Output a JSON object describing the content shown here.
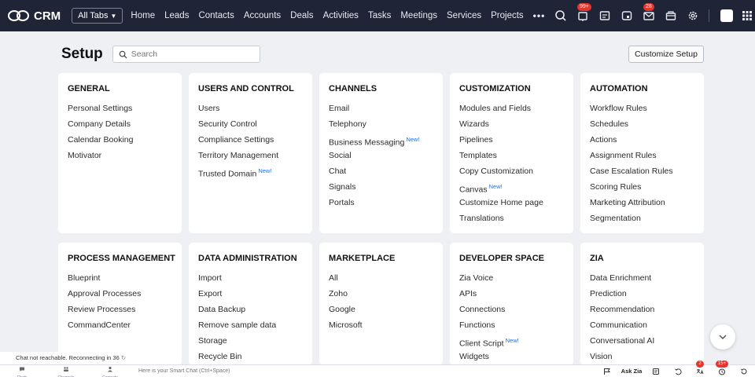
{
  "app": {
    "logo_text": "CRM",
    "all_tabs": "All Tabs"
  },
  "nav": [
    "Home",
    "Leads",
    "Contacts",
    "Accounts",
    "Deals",
    "Activities",
    "Tasks",
    "Meetings",
    "Services",
    "Projects"
  ],
  "nav_more": "•••",
  "top_badges": {
    "notifications": "99+",
    "mail": "28"
  },
  "setup": {
    "title": "Setup",
    "search_placeholder": "Search",
    "customize_button": "Customize Setup"
  },
  "new_label": "New!",
  "sections": [
    {
      "title": "GENERAL",
      "items": [
        {
          "label": "Personal Settings"
        },
        {
          "label": "Company Details"
        },
        {
          "label": "Calendar Booking"
        },
        {
          "label": "Motivator"
        }
      ]
    },
    {
      "title": "USERS AND CONTROL",
      "items": [
        {
          "label": "Users"
        },
        {
          "label": "Security Control"
        },
        {
          "label": "Compliance Settings"
        },
        {
          "label": "Territory Management"
        },
        {
          "label": "Trusted Domain",
          "new": true
        }
      ]
    },
    {
      "title": "CHANNELS",
      "items": [
        {
          "label": "Email"
        },
        {
          "label": "Telephony"
        },
        {
          "label": "Business Messaging",
          "new": true
        },
        {
          "label": "Social"
        },
        {
          "label": "Chat"
        },
        {
          "label": "Signals"
        },
        {
          "label": "Portals"
        }
      ]
    },
    {
      "title": "CUSTOMIZATION",
      "items": [
        {
          "label": "Modules and Fields"
        },
        {
          "label": "Wizards"
        },
        {
          "label": "Pipelines"
        },
        {
          "label": "Templates"
        },
        {
          "label": "Copy Customization"
        },
        {
          "label": "Canvas",
          "new": true
        },
        {
          "label": "Customize Home page"
        },
        {
          "label": "Translations"
        }
      ]
    },
    {
      "title": "AUTOMATION",
      "items": [
        {
          "label": "Workflow Rules"
        },
        {
          "label": "Schedules"
        },
        {
          "label": "Actions"
        },
        {
          "label": "Assignment Rules"
        },
        {
          "label": "Case Escalation Rules"
        },
        {
          "label": "Scoring Rules"
        },
        {
          "label": "Marketing Attribution"
        },
        {
          "label": "Segmentation"
        }
      ]
    },
    {
      "title": "PROCESS MANAGEMENT",
      "items": [
        {
          "label": "Blueprint"
        },
        {
          "label": "Approval Processes"
        },
        {
          "label": "Review Processes"
        },
        {
          "label": "CommandCenter"
        }
      ]
    },
    {
      "title": "DATA ADMINISTRATION",
      "items": [
        {
          "label": "Import"
        },
        {
          "label": "Export"
        },
        {
          "label": "Data Backup"
        },
        {
          "label": "Remove sample data"
        },
        {
          "label": "Storage"
        },
        {
          "label": "Recycle Bin"
        }
      ]
    },
    {
      "title": "MARKETPLACE",
      "items": [
        {
          "label": "All"
        },
        {
          "label": "Zoho"
        },
        {
          "label": "Google"
        },
        {
          "label": "Microsoft"
        }
      ]
    },
    {
      "title": "DEVELOPER SPACE",
      "items": [
        {
          "label": "Zia Voice"
        },
        {
          "label": "APIs"
        },
        {
          "label": "Connections"
        },
        {
          "label": "Functions"
        },
        {
          "label": "Client Script",
          "new": true
        },
        {
          "label": "Widgets"
        }
      ]
    },
    {
      "title": "ZIA",
      "items": [
        {
          "label": "Data Enrichment"
        },
        {
          "label": "Prediction"
        },
        {
          "label": "Recommendation"
        },
        {
          "label": "Communication"
        },
        {
          "label": "Conversational AI"
        },
        {
          "label": "Vision"
        }
      ]
    }
  ],
  "chat_status": "Chat not reachable. Reconnecting in 36",
  "bottom": {
    "items": [
      "Chats",
      "Channels",
      "Contacts"
    ],
    "smart_chat_placeholder": "Here is your Smart Chat (Ctrl+Space)",
    "ask_zia": "Ask Zia",
    "badge_a": "2",
    "badge_b": "15+"
  }
}
